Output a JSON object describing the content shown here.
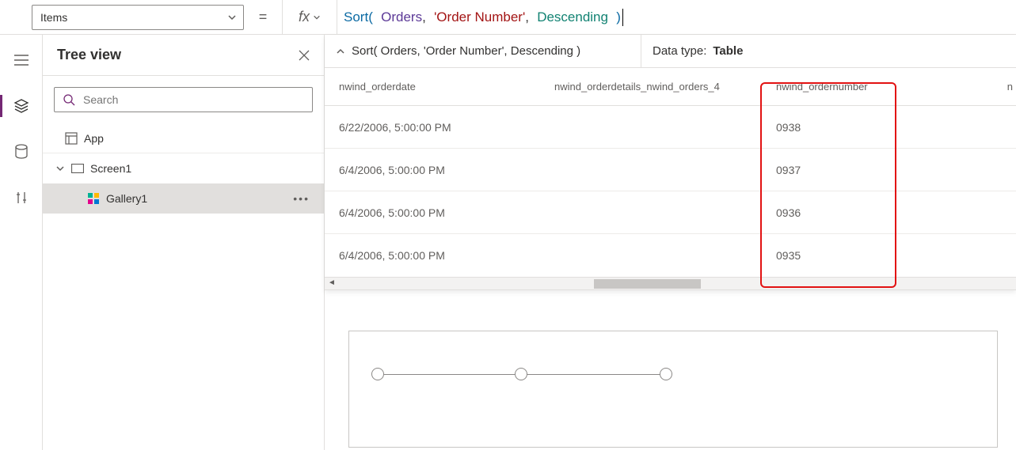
{
  "property_dropdown": {
    "value": "Items"
  },
  "equals": "=",
  "fx_label": "fx",
  "formula": {
    "fn": "Sort",
    "arg1": "Orders",
    "arg2": "'Order Number'",
    "arg3": "Descending"
  },
  "result_header": {
    "summary": "Sort( Orders, 'Order Number', Descending )",
    "datatype_label": "Data type: ",
    "datatype_value": "Table"
  },
  "columns": {
    "c1": "nwind_orderdate",
    "c2": "nwind_orderdetails_nwind_orders_4",
    "c3": "nwind_ordernumber",
    "c4": "n"
  },
  "rows": [
    {
      "date": "6/22/2006, 5:00:00 PM",
      "num": "0938"
    },
    {
      "date": "6/4/2006, 5:00:00 PM",
      "num": "0937"
    },
    {
      "date": "6/4/2006, 5:00:00 PM",
      "num": "0936"
    },
    {
      "date": "6/4/2006, 5:00:00 PM",
      "num": "0935"
    }
  ],
  "tree": {
    "title": "Tree view",
    "search_placeholder": "Search",
    "app": "App",
    "screen": "Screen1",
    "gallery": "Gallery1"
  }
}
